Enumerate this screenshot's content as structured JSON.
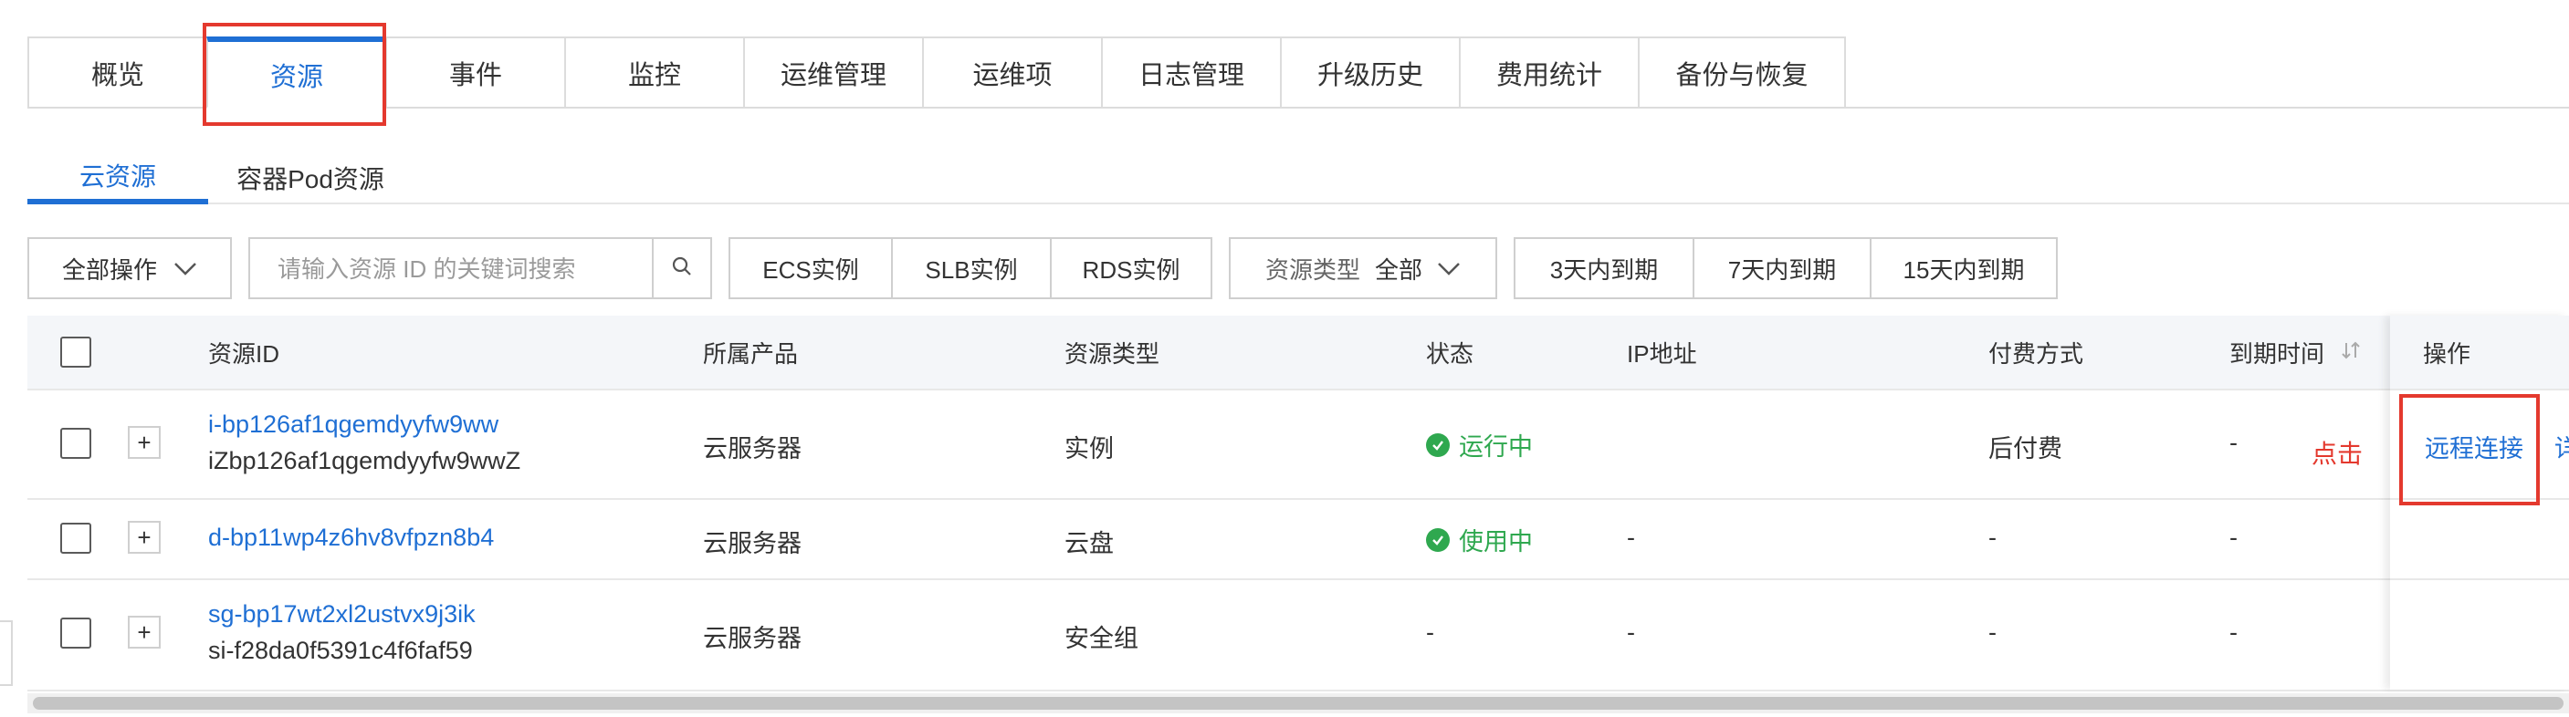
{
  "main_tabs": [
    "概览",
    "资源",
    "事件",
    "监控",
    "运维管理",
    "运维项",
    "日志管理",
    "升级历史",
    "费用统计",
    "备份与恢复"
  ],
  "sub_tabs": [
    "云资源",
    "容器Pod资源"
  ],
  "toolbar": {
    "bulk_action": "全部操作",
    "search_placeholder": "请输入资源 ID 的关键词搜索",
    "instance_filters": [
      "ECS实例",
      "SLB实例",
      "RDS实例"
    ],
    "resource_type_label": "资源类型",
    "resource_type_value": "全部",
    "expiry_filters": [
      "3天内到期",
      "7天内到期",
      "15天内到期"
    ]
  },
  "table": {
    "headers": [
      "资源ID",
      "所属产品",
      "资源类型",
      "状态",
      "IP地址",
      "付费方式",
      "到期时间",
      "操作"
    ],
    "rows": [
      {
        "id": "i-bp126af1qgemdyyfw9ww",
        "sub_id": "iZbp126af1qgemdyyfw9wwZ",
        "product": "云服务器",
        "type": "实例",
        "status": "运行中",
        "ip": "",
        "billing": "后付费",
        "expiry": "-",
        "action": "远程连接",
        "action_more": "详"
      },
      {
        "id": "d-bp11wp4z6hv8vfpzn8b4",
        "sub_id": "",
        "product": "云服务器",
        "type": "云盘",
        "status": "使用中",
        "ip": "-",
        "billing": "-",
        "expiry": "-",
        "action": "",
        "action_more": ""
      },
      {
        "id": "sg-bp17wt2xl2ustvx9j3ik",
        "sub_id": "si-f28da0f5391c4f6faf59",
        "product": "云服务器",
        "type": "安全组",
        "status": "-",
        "ip": "-",
        "billing": "-",
        "expiry": "-",
        "action": "",
        "action_more": ""
      }
    ]
  },
  "annotation": {
    "click_hint": "点击"
  },
  "colors": {
    "accent": "#1f6fd4",
    "success": "#2fa84f",
    "highlight": "#e4392e"
  }
}
